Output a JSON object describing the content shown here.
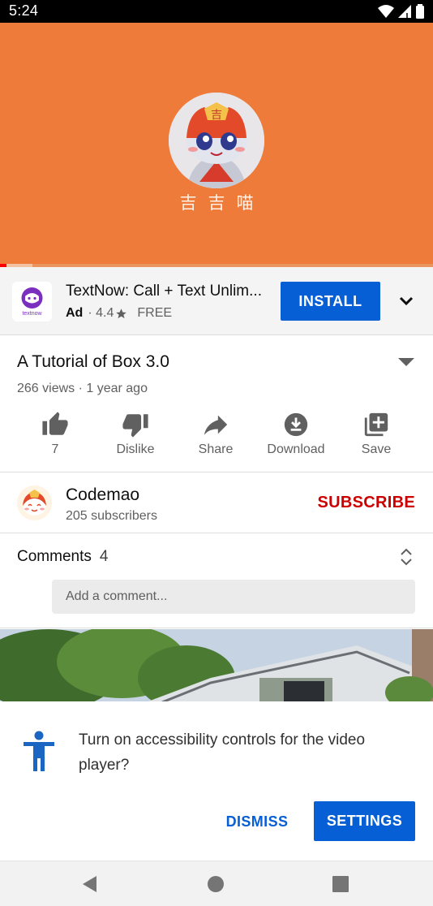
{
  "status_bar": {
    "time": "5:24"
  },
  "player": {
    "caption": "吉吉喵",
    "progress_played": 0.015,
    "progress_buffered": 0.075
  },
  "ad": {
    "app_title": "TextNow: Call + Text Unlim...",
    "badge": "Ad",
    "rating": "4.4",
    "price": "FREE",
    "app_icon_label": "textnow",
    "install_label": "INSTALL"
  },
  "video": {
    "title": "A Tutorial of Box 3.0",
    "stats": "266 views · 1 year ago",
    "actions": [
      {
        "label": "7",
        "icon": "thumb-up-icon"
      },
      {
        "label": "Dislike",
        "icon": "thumb-down-icon"
      },
      {
        "label": "Share",
        "icon": "share-icon"
      },
      {
        "label": "Download",
        "icon": "download-icon"
      },
      {
        "label": "Save",
        "icon": "playlist-add-icon"
      }
    ]
  },
  "channel": {
    "name": "Codemao",
    "subscribers": "205 subscribers",
    "subscribe_label": "SUBSCRIBE"
  },
  "comments": {
    "label": "Comments",
    "count": "4",
    "placeholder": "Add a comment..."
  },
  "a11y_dialog": {
    "message": "Turn on accessibility controls for the video player?",
    "dismiss_label": "DISMISS",
    "settings_label": "SETTINGS"
  },
  "colors": {
    "brand_orange": "#ee7b3a",
    "accent_blue": "#065fd4",
    "subscribe_red": "#cc0000"
  }
}
